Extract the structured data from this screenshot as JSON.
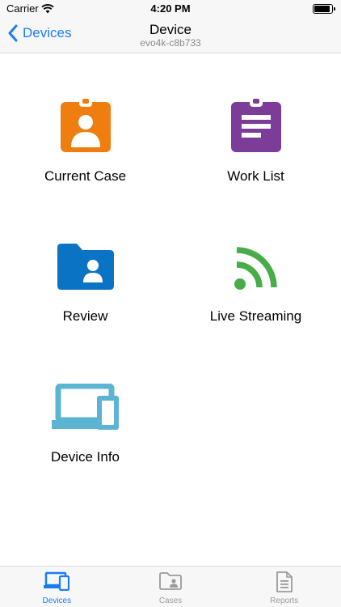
{
  "status_bar": {
    "carrier": "Carrier",
    "time": "4:20 PM"
  },
  "nav": {
    "back_label": "Devices",
    "title": "Device",
    "subtitle": "evo4k-c8b733"
  },
  "tiles": [
    {
      "label": "Current Case",
      "icon": "contact-clipboard-icon",
      "color": "#f07d0f"
    },
    {
      "label": "Work List",
      "icon": "clipboard-list-icon",
      "color": "#7b3d97"
    },
    {
      "label": "Review",
      "icon": "user-folder-icon",
      "color": "#0b73c4"
    },
    {
      "label": "Live Streaming",
      "icon": "rss-icon",
      "color": "#48ad48"
    },
    {
      "label": "Device Info",
      "icon": "devices-icon",
      "color": "#5bb4d1"
    }
  ],
  "tab_bar": {
    "items": [
      {
        "label": "Devices",
        "icon": "devices-icon",
        "active": true
      },
      {
        "label": "Cases",
        "icon": "user-folder-icon",
        "active": false
      },
      {
        "label": "Reports",
        "icon": "document-icon",
        "active": false
      }
    ],
    "active_color": "#1a7cf5",
    "inactive_color": "#9a9a9a"
  }
}
